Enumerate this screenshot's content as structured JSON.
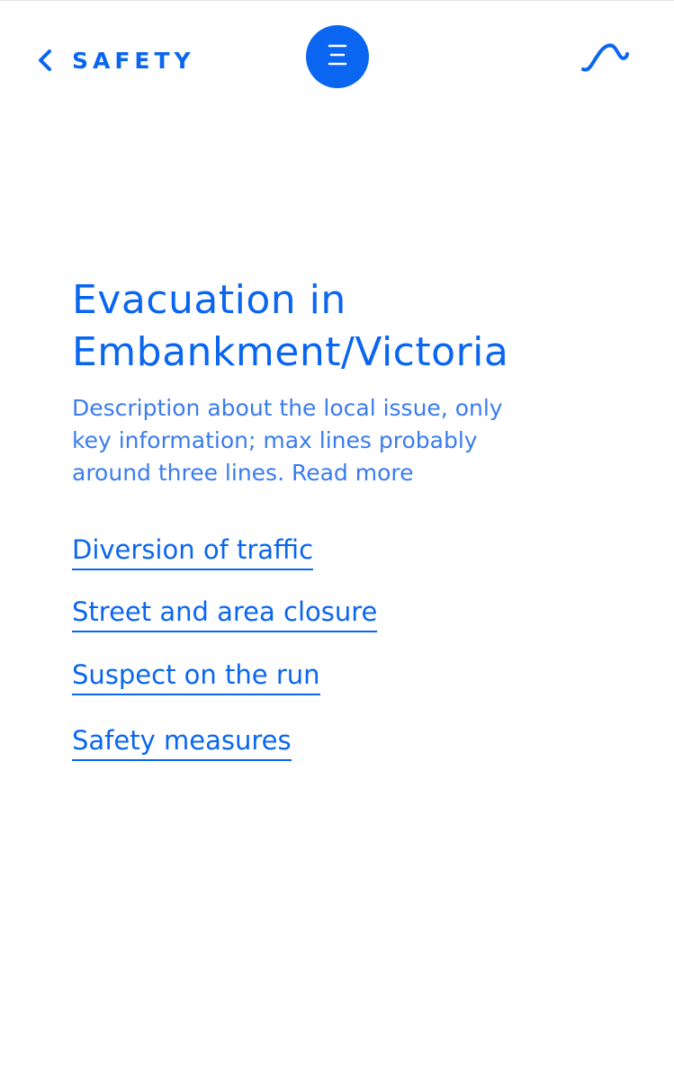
{
  "header": {
    "back_label": "SAFETY",
    "back_icon": "chevron-left-icon",
    "menu_icon": "menu-icon",
    "brand_icon": "wave-icon",
    "accent_color": "#0a66f0"
  },
  "article": {
    "title_line1": "Evacuation in",
    "title_line2": "Embankment/Victoria",
    "description_line1": "Description about the local issue, only",
    "description_line2": "key information; max lines probably",
    "description_line3": "around three lines. Read more"
  },
  "links": [
    {
      "label": "Diversion of traffic"
    },
    {
      "label": "Street and area closure"
    },
    {
      "label": "Suspect on the run"
    },
    {
      "label": "Safety measures"
    }
  ]
}
